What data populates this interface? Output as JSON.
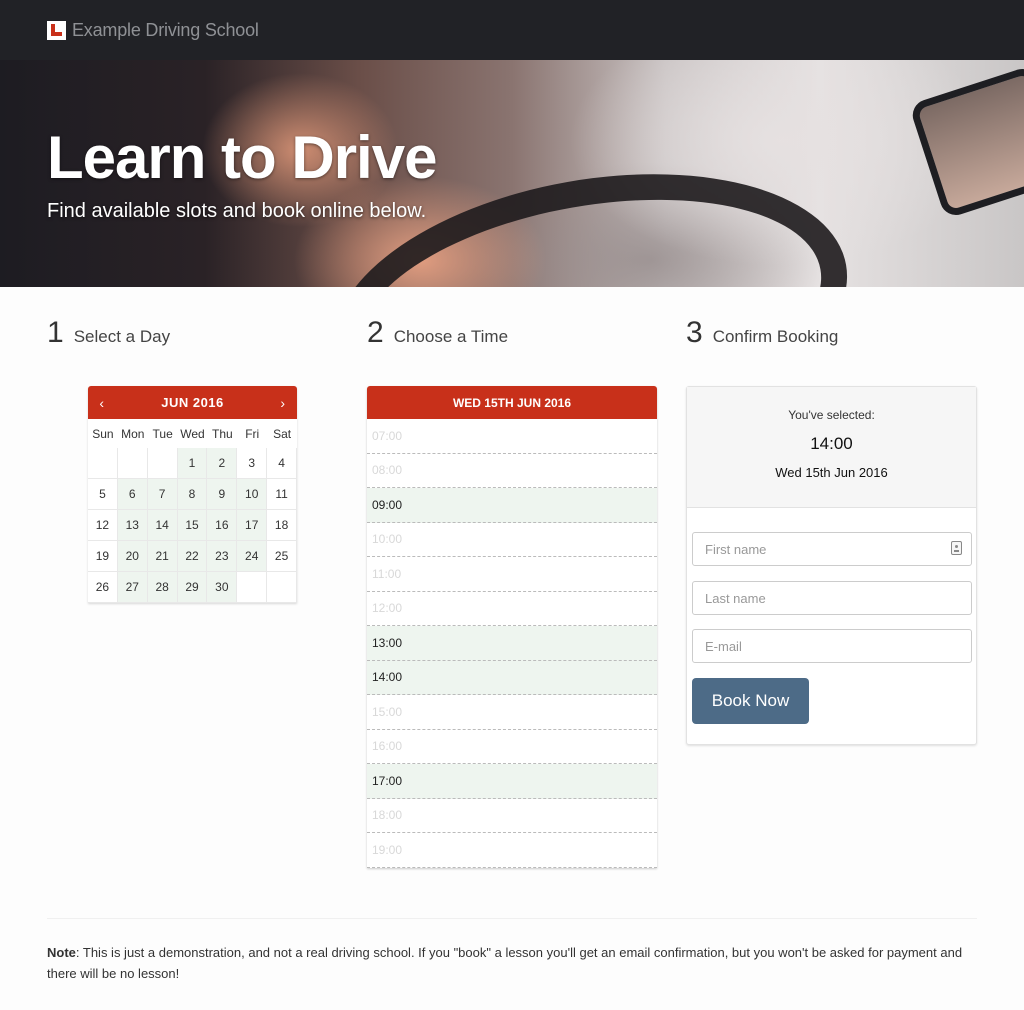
{
  "brand": {
    "name": "Example Driving School"
  },
  "hero": {
    "title": "Learn to Drive",
    "subtitle": "Find available slots and book online below."
  },
  "steps": [
    {
      "num": "1",
      "label": "Select a Day"
    },
    {
      "num": "2",
      "label": "Choose a Time"
    },
    {
      "num": "3",
      "label": "Confirm Booking"
    }
  ],
  "calendar": {
    "month_label": "JUN 2016",
    "prev_glyph": "‹",
    "next_glyph": "›",
    "weekdays": [
      "Sun",
      "Mon",
      "Tue",
      "Wed",
      "Thu",
      "Fri",
      "Sat"
    ],
    "days": [
      "",
      "",
      "",
      "1",
      "2",
      "3",
      "4",
      "5",
      "6",
      "7",
      "8",
      "9",
      "10",
      "11",
      "12",
      "13",
      "14",
      "15",
      "16",
      "17",
      "18",
      "19",
      "20",
      "21",
      "22",
      "23",
      "24",
      "25",
      "26",
      "27",
      "28",
      "29",
      "30",
      "",
      ""
    ],
    "available_days": [
      "1",
      "2",
      "6",
      "7",
      "8",
      "9",
      "10",
      "13",
      "14",
      "15",
      "16",
      "17",
      "20",
      "21",
      "22",
      "23",
      "24",
      "27",
      "28",
      "29",
      "30"
    ]
  },
  "times": {
    "header": "WED 15TH JUN 2016",
    "slots": [
      {
        "time": "07:00",
        "available": false
      },
      {
        "time": "08:00",
        "available": false
      },
      {
        "time": "09:00",
        "available": true
      },
      {
        "time": "10:00",
        "available": false
      },
      {
        "time": "11:00",
        "available": false
      },
      {
        "time": "12:00",
        "available": false
      },
      {
        "time": "13:00",
        "available": true
      },
      {
        "time": "14:00",
        "available": true
      },
      {
        "time": "15:00",
        "available": false
      },
      {
        "time": "16:00",
        "available": false
      },
      {
        "time": "17:00",
        "available": true
      },
      {
        "time": "18:00",
        "available": false
      },
      {
        "time": "19:00",
        "available": false
      }
    ]
  },
  "confirm": {
    "selected_label": "You've selected:",
    "selected_time": "14:00",
    "selected_date": "Wed 15th Jun 2016",
    "first_name_placeholder": "First name",
    "last_name_placeholder": "Last name",
    "email_placeholder": "E-mail",
    "book_button": "Book Now"
  },
  "note": {
    "bold": "Note",
    "text": ": This is just a demonstration, and not a real driving school. If you \"book\" a lesson you'll get an email confirmation, but you won't be asked for payment and there will be no lesson!"
  },
  "colors": {
    "header_red": "#c8301a",
    "available_bg": "#eef5ef",
    "button_blue": "#4d6b87",
    "navbar": "#212226"
  }
}
